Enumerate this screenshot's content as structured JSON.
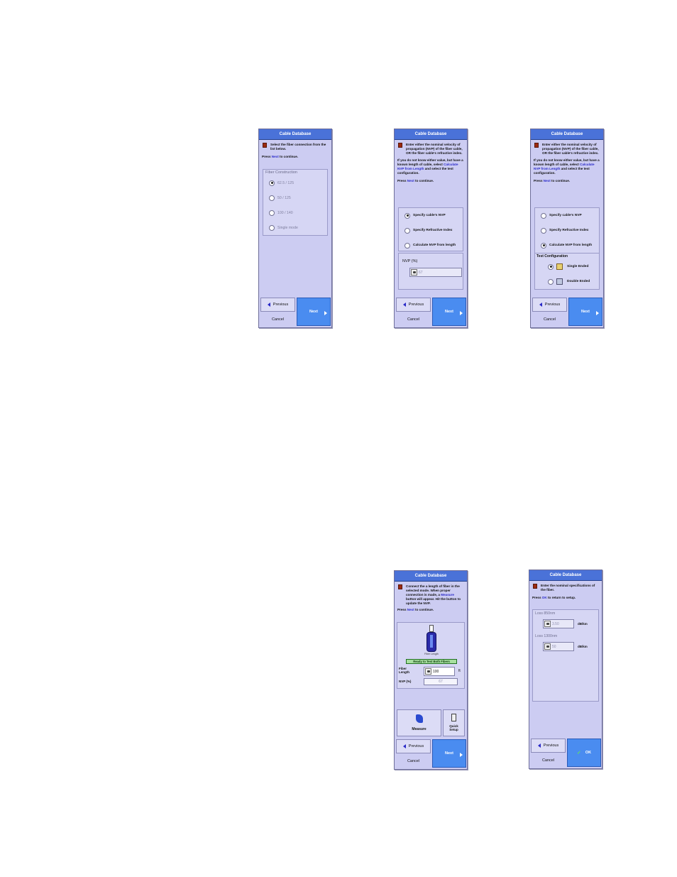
{
  "screens": [
    {
      "title": "Cable Database",
      "instruction": "Select the fiber connection from the list below.",
      "press_prefix": "Press ",
      "press_key": "Next",
      "press_suffix": " to continue.",
      "group_label": "Fiber Construction",
      "options": [
        "62.5 / 125",
        "50 / 125",
        "100 / 140",
        "Single mode"
      ],
      "selected_option": "62.5 / 125",
      "previous_label": "Previous",
      "cancel_label": "Cancel",
      "next_label": "Next"
    },
    {
      "title": "Cable Database",
      "instruction_1": "Enter either the nominal velocity of propagation (NVP) of the fiber cable, OR the fiber cable's refractive index.",
      "instruction_2a": "If you do not know either value, but have a known length of cable, select ",
      "instruction_2b": "Calculate NVP from Length",
      "instruction_2c": " and select the test configuration.",
      "press_prefix": "Press ",
      "press_key": "Next",
      "press_suffix": " to continue.",
      "options": [
        "Specify cable's NVP",
        "Specify Refractive Index",
        "Calculate NVP from length"
      ],
      "selected_option": "Specify cable's NVP",
      "nvp_label": "NVP (%)",
      "nvp_value": "67",
      "previous_label": "Previous",
      "cancel_label": "Cancel",
      "next_label": "Next"
    },
    {
      "title": "Cable Database",
      "instruction_1": "Enter either the nominal velocity of propagation (NVP) of the fiber cable, OR the fiber cable's refractive index.",
      "instruction_2a": "If you do not know either value, but have a known length of cable, select ",
      "instruction_2b": "Calculate NVP from Length",
      "instruction_2c": " and select the test configuration.",
      "press_prefix": "Press ",
      "press_key": "Next",
      "press_suffix": " to continue.",
      "options": [
        "Specify cable's NVP",
        "Specify Refractive Index",
        "Calculate NVP from length"
      ],
      "selected_option": "Calculate NVP from length",
      "test_config_label": "Test Configuration",
      "config_options": [
        "Single Ended",
        "Double Ended"
      ],
      "selected_config": "Single Ended",
      "previous_label": "Previous",
      "cancel_label": "Cancel",
      "next_label": "Next"
    },
    {
      "title": "Cable Database",
      "instruction_a": "Connect the a length of fiber in the selected mode. When proper connection is made, a ",
      "instruction_b": "Measure",
      "instruction_c": " button will appear. Hit the button to update the NVP.",
      "press_prefix": "Press ",
      "press_key": "Next",
      "press_suffix": " to continue.",
      "device_caption": "Fiber Length",
      "status_text": "Ready to Test Both Fibers",
      "length_label": "Fiber Length",
      "length_value": "100",
      "length_unit": "ft",
      "nvp_label": "NVP (%)",
      "nvp_value": "67",
      "measure_label": "Measure",
      "quick_setup_label": "Quick Setup",
      "previous_label": "Previous",
      "cancel_label": "Cancel",
      "next_label": "Next"
    },
    {
      "title": "Cable Database",
      "instruction": "Enter the nominal specifications of the fiber.",
      "press_prefix": "Press ",
      "press_key": "OK",
      "press_suffix": " to return to setup.",
      "loss1_label": "Loss 850nm",
      "loss1_value": "3.50",
      "loss1_unit": "dB/km",
      "loss2_label": "Loss 1300nm",
      "loss2_value": "50",
      "loss2_unit": "dB/km",
      "previous_label": "Previous",
      "cancel_label": "Cancel",
      "ok_label": "OK"
    }
  ]
}
